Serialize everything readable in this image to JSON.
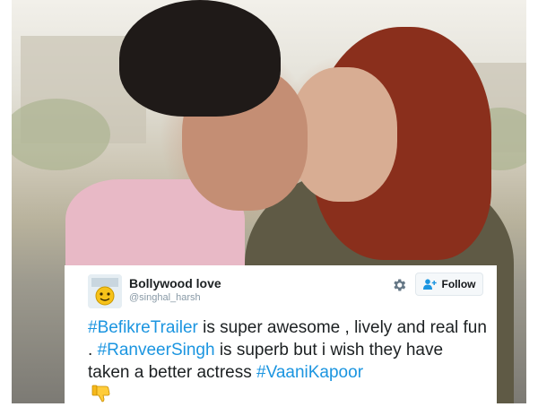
{
  "tweet": {
    "user_name": "Bollywood love",
    "user_handle": "@singhal_harsh",
    "follow_label": "Follow",
    "text_parts": {
      "tag1": "#BefikreTrailer",
      "t1": " is super awesome , lively and real fun . ",
      "tag2": "#RanveerSingh",
      "t2": " is superb but i wish they have taken a better actress ",
      "tag3": "#VaaniKapoor"
    },
    "icons": {
      "settings": "gear-icon",
      "follow": "add-user-icon",
      "emoji": "thumbs-down-icon",
      "avatar": "avatar-emoji"
    }
  },
  "colors": {
    "hashtag": "#1b95e0",
    "name": "#1c2022",
    "handle": "#8899a6"
  }
}
